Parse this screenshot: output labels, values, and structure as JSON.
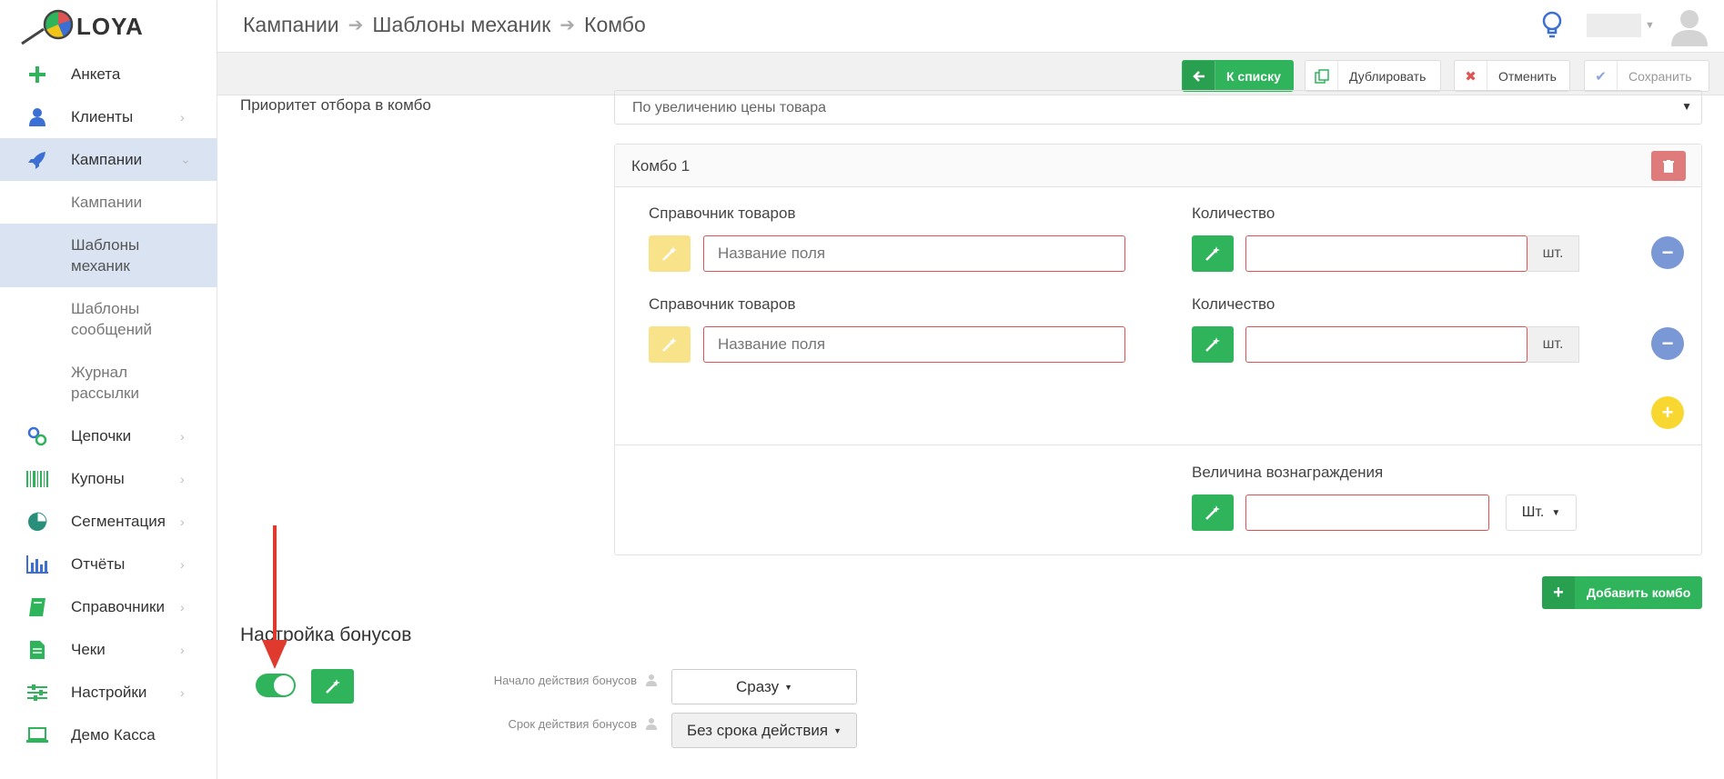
{
  "app": {
    "name": "LOYA"
  },
  "header": {
    "breadcrumb": [
      "Кампании",
      "Шаблоны механик",
      "Комбо"
    ]
  },
  "sidebar": {
    "items": [
      {
        "label": "Анкета",
        "icon": "plus-icon",
        "chevron": false
      },
      {
        "label": "Клиенты",
        "icon": "user-icon",
        "chevron": true
      },
      {
        "label": "Кампании",
        "icon": "rocket-icon",
        "chevron": true,
        "active": true
      }
    ],
    "subitems": [
      {
        "label": "Кампании"
      },
      {
        "label": "Шаблоны механик",
        "active": true
      },
      {
        "label": "Шаблоны сообщений"
      },
      {
        "label": "Журнал рассылки"
      }
    ],
    "items2": [
      {
        "label": "Цепочки",
        "icon": "link-icon"
      },
      {
        "label": "Купоны",
        "icon": "barcode-icon"
      },
      {
        "label": "Сегментация",
        "icon": "pie-icon"
      },
      {
        "label": "Отчёты",
        "icon": "bar-chart-icon"
      },
      {
        "label": "Справочники",
        "icon": "book-icon"
      },
      {
        "label": "Чеки",
        "icon": "receipt-icon"
      },
      {
        "label": "Настройки",
        "icon": "sliders-icon"
      },
      {
        "label": "Демо Касса",
        "icon": "laptop-icon"
      }
    ]
  },
  "toolbar": {
    "back": "К списку",
    "duplicate": "Дублировать",
    "cancel": "Отменить",
    "save": "Сохранить"
  },
  "form": {
    "priority_label": "Приоритет отбора в комбо",
    "priority_value": "По увеличению цены товара",
    "combo": {
      "title": "Комбо 1",
      "rows": [
        {
          "product_label": "Справочник товаров",
          "product_placeholder": "Название поля",
          "qty_label": "Количество",
          "unit": "шт."
        },
        {
          "product_label": "Справочник товаров",
          "product_placeholder": "Название поля",
          "qty_label": "Количество",
          "unit": "шт."
        }
      ],
      "reward_label": "Величина вознаграждения",
      "reward_unit": "Шт."
    },
    "add_combo": "Добавить комбо",
    "bonus_section": "Настройка бонусов",
    "bonus_start_label": "Начало действия бонусов",
    "bonus_start_value": "Сразу",
    "bonus_term_label": "Срок действия бонусов",
    "bonus_term_value": "Без срока действия"
  },
  "colors": {
    "green": "#2fb35b",
    "active_bg": "#d9e3f2",
    "danger": "#e05353",
    "blue_btn": "#7a97d6",
    "yellow_btn": "#f8d830"
  }
}
